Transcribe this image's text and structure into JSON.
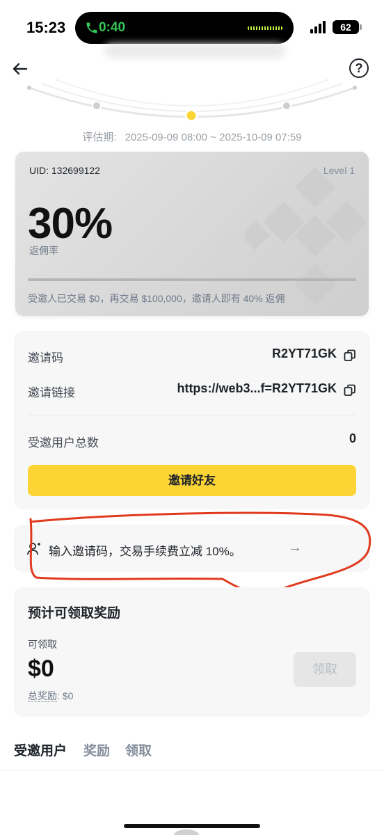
{
  "status_bar": {
    "time": "15:23",
    "call_duration": "0:40",
    "battery": "62",
    "icons": [
      "phone-icon",
      "signal-icon",
      "battery-icon"
    ]
  },
  "header": {
    "back_icon": "arrow-left-icon",
    "help_label": "?"
  },
  "evaluation": {
    "label": "评估期:",
    "range": "2025-09-09 08:00 ~ 2025-10-09 07:59"
  },
  "commission_card": {
    "uid": "UID: 132699122",
    "level": "Level 1",
    "rate": "30%",
    "rate_label": "返佣率",
    "progress_fraction": 0,
    "note": "受邀人已交易 $0，再交易 $100,000，邀请人即有 40% 返佣"
  },
  "invite": {
    "code_label": "邀请码",
    "code_value": "R2YT71GK",
    "link_label": "邀请链接",
    "link_value": "https://web3...f=R2YT71GK",
    "total_label": "受邀用户总数",
    "total_value": "0",
    "button_label": "邀请好友"
  },
  "referral_banner": {
    "text": "输入邀请码，交易手续费立减 10%。",
    "arrow": "→"
  },
  "rewards": {
    "title": "预计可领取奖励",
    "claimable_label": "可领取",
    "claimable_amount": "$0",
    "total_label": "总奖励",
    "total_value": ": $0",
    "claim_button": "领取"
  },
  "tabs": [
    {
      "label": "受邀用户",
      "active": true
    },
    {
      "label": "奖励",
      "active": false
    },
    {
      "label": "领取",
      "active": false
    }
  ],
  "colors": {
    "accent": "#fcd535",
    "annotation": "#e03a1e",
    "text_primary": "#1e2329",
    "text_secondary": "#848e9c"
  }
}
